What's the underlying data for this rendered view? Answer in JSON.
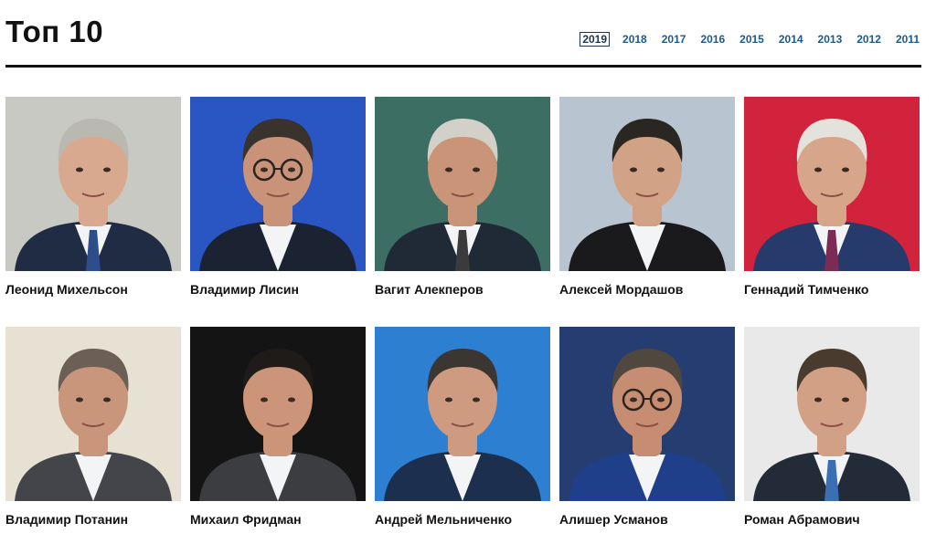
{
  "header": {
    "title": "Топ 10",
    "years": [
      "2019",
      "2018",
      "2017",
      "2016",
      "2015",
      "2014",
      "2013",
      "2012",
      "2011"
    ],
    "active_year": "2019"
  },
  "people": [
    {
      "name": "Леонид Михельсон",
      "bg": "#c9c9c4",
      "suit": "#1f2c44",
      "skin": "#d9a98f",
      "hair": "#b9b9b2",
      "glasses": false,
      "tie": "#2d4e8a"
    },
    {
      "name": "Владимир Лисин",
      "bg": "#2a56c4",
      "suit": "#1b2333",
      "skin": "#c9937a",
      "hair": "#3a332d",
      "glasses": true,
      "tie": ""
    },
    {
      "name": "Вагит Алекперов",
      "bg": "#3d6e63",
      "suit": "#202a36",
      "skin": "#c99478",
      "hair": "#d2d0c8",
      "glasses": false,
      "tie": "#3b3b3b"
    },
    {
      "name": "Алексей Мордашов",
      "bg": "#b8c4cf",
      "suit": "#1a1a1c",
      "skin": "#d2a286",
      "hair": "#2a2622",
      "glasses": false,
      "tie": ""
    },
    {
      "name": "Геннадий Тимченко",
      "bg": "#d1233c",
      "suit": "#263a6b",
      "skin": "#d7a58a",
      "hair": "#e4e2dc",
      "glasses": false,
      "tie": "#7c2b55"
    },
    {
      "name": "Владимир Потанин",
      "bg": "#e6e1d3",
      "suit": "#43454a",
      "skin": "#c9967c",
      "hair": "#6b5f56",
      "glasses": false,
      "tie": ""
    },
    {
      "name": "Михаил Фридман",
      "bg": "#141414",
      "suit": "#3b3d40",
      "skin": "#cc9478",
      "hair": "#1f1b18",
      "glasses": false,
      "tie": ""
    },
    {
      "name": "Андрей Мельниченко",
      "bg": "#2d7fd1",
      "suit": "#1c2f4f",
      "skin": "#cf9b80",
      "hair": "#3b3632",
      "glasses": false,
      "tie": ""
    },
    {
      "name": "Алишер Усманов",
      "bg": "#263d72",
      "suit": "#1f3f8a",
      "skin": "#c78d72",
      "hair": "#50473f",
      "glasses": true,
      "tie": ""
    },
    {
      "name": "Роман Абрамович",
      "bg": "#e9e9ea",
      "suit": "#232a38",
      "skin": "#d2a085",
      "hair": "#4a3b2f",
      "glasses": false,
      "tie": "#3b6fb4"
    }
  ]
}
